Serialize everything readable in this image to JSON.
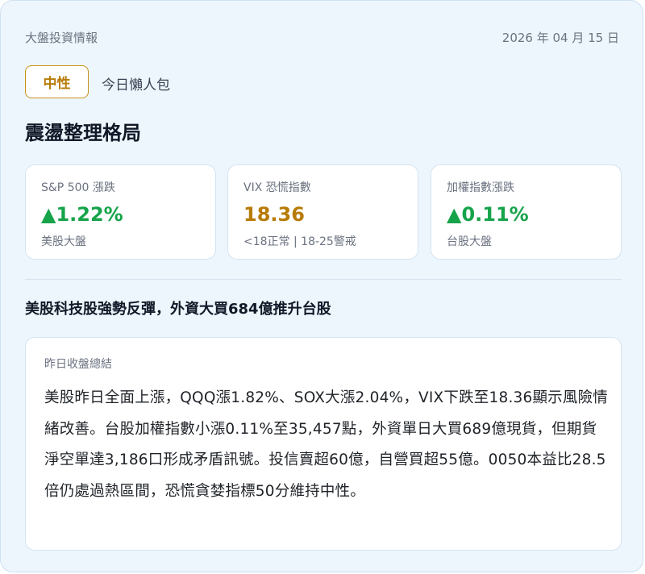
{
  "header": {
    "section_title": "大盤投資情報",
    "date": "2026 年 04 月 15 日"
  },
  "sentiment": {
    "badge": "中性",
    "caption": "今日懶人包",
    "badge_color": "#b77b06"
  },
  "headline": "震盪整理格局",
  "metrics": [
    {
      "label": "S&P 500 漲跌",
      "value": "▲1.22%",
      "note": "美股大盤",
      "color": "#16a34a"
    },
    {
      "label": "VIX 恐慌指數",
      "value": "18.36",
      "note": "<18正常 | 18-25警戒",
      "color": "#b77b06"
    },
    {
      "label": "加權指數漲跌",
      "value": "▲0.11%",
      "note": "台股大盤",
      "color": "#16a34a"
    }
  ],
  "subheadline": "美股科技股強勢反彈，外資大買684億推升台股",
  "summary": {
    "label": "昨日收盤總結",
    "body": "美股昨日全面上漲，QQQ漲1.82%、SOX大漲2.04%，VIX下跌至18.36顯示風險情緒改善。台股加權指數小漲0.11%至35,457點，外資單日大買689億現貨，但期貨淨空單達3,186口形成矛盾訊號。投信賣超60億，自營買超55億。0050本益比28.5倍仍處過熱區間，恐慌貪婪指標50分維持中性。"
  }
}
